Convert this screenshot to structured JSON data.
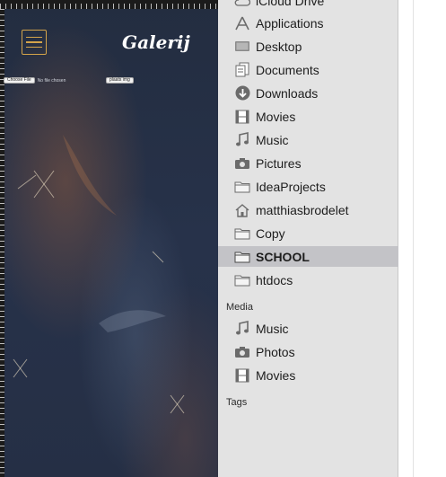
{
  "app": {
    "title": "Galerij",
    "choose_file_label": "Choose File",
    "file_status": "No file chosen",
    "upload_label": "plaats img"
  },
  "finder": {
    "favorites": [
      {
        "label": "iCloud Drive",
        "icon": "cloud-icon"
      },
      {
        "label": "Applications",
        "icon": "applications-icon"
      },
      {
        "label": "Desktop",
        "icon": "desktop-icon"
      },
      {
        "label": "Documents",
        "icon": "documents-icon"
      },
      {
        "label": "Downloads",
        "icon": "download-icon"
      },
      {
        "label": "Movies",
        "icon": "film-icon"
      },
      {
        "label": "Music",
        "icon": "music-note-icon"
      },
      {
        "label": "Pictures",
        "icon": "camera-icon"
      },
      {
        "label": "IdeaProjects",
        "icon": "folder-icon"
      },
      {
        "label": "matthiasbrodelet",
        "icon": "home-icon"
      },
      {
        "label": "Copy",
        "icon": "folder-icon"
      },
      {
        "label": "SCHOOL",
        "icon": "folder-icon",
        "selected": true
      },
      {
        "label": "htdocs",
        "icon": "folder-icon"
      }
    ],
    "media_header": "Media",
    "media": [
      {
        "label": "Music",
        "icon": "music-note-icon"
      },
      {
        "label": "Photos",
        "icon": "camera-icon"
      },
      {
        "label": "Movies",
        "icon": "film-icon"
      }
    ],
    "tags_header": "Tags"
  },
  "colors": {
    "accent": "#d4a44a",
    "app_bg": "#27324a",
    "sidebar_bg": "#e3e3e3",
    "selection": "#c3c3c7"
  }
}
